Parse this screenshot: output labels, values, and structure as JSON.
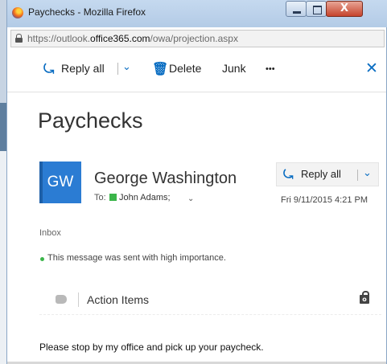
{
  "window": {
    "title": "Paychecks - Mozilla Firefox",
    "minimize_glyph": "",
    "maximize_glyph": "",
    "close_glyph": "X"
  },
  "address_bar": {
    "url_prefix": "https://outlook.",
    "url_domain": "office365.com",
    "url_path": "/owa/projection.aspx"
  },
  "toolbar": {
    "reply_all_label": "Reply all",
    "delete_label": "Delete",
    "junk_label": "Junk",
    "more_label": "•••",
    "close_label": "✕"
  },
  "message": {
    "subject": "Paychecks",
    "sender_initials": "GW",
    "sender_name": "George Washington",
    "to_label": "To:",
    "recipient": "John Adams;",
    "reply_all_label": "Reply all",
    "date": "Fri 9/11/2015 4:21 PM",
    "folder": "Inbox",
    "importance_text": "This message was sent with high importance.",
    "action_items_label": "Action Items",
    "body": "Please stop by my office and pick up your paycheck."
  },
  "colors": {
    "accent": "#0a6dc2",
    "avatar": "#2b7cd3",
    "presence": "#3bb54a"
  }
}
